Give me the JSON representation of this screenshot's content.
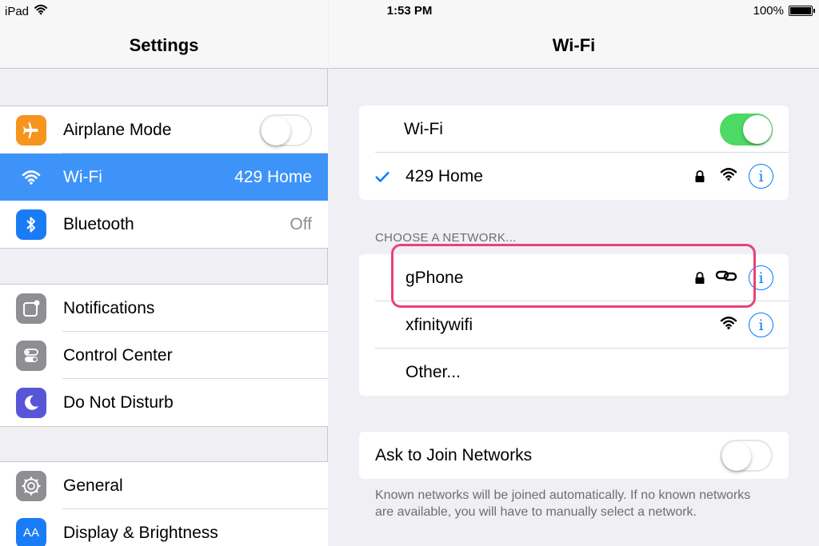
{
  "status_bar": {
    "device": "iPad",
    "time": "1:53 PM",
    "battery": "100%",
    "battery_level": 1.0
  },
  "left_pane": {
    "title": "Settings",
    "groups": [
      {
        "items": [
          {
            "label": "Airplane Mode",
            "icon": "airplane-icon",
            "icon_color": "#f7941d",
            "toggle": "off"
          },
          {
            "label": "Wi-Fi",
            "icon": "wifi-icon",
            "icon_color": "#3d93f8",
            "value": "429 Home",
            "selected": true
          },
          {
            "label": "Bluetooth",
            "icon": "bluetooth-icon",
            "icon_color": "#1a7cf5",
            "value": "Off"
          }
        ]
      },
      {
        "items": [
          {
            "label": "Notifications",
            "icon": "notifications-icon",
            "icon_color": "#8e8e93"
          },
          {
            "label": "Control Center",
            "icon": "control-center-icon",
            "icon_color": "#8e8e93"
          },
          {
            "label": "Do Not Disturb",
            "icon": "moon-icon",
            "icon_color": "#5856d6"
          }
        ]
      },
      {
        "items": [
          {
            "label": "General",
            "icon": "gear-icon",
            "icon_color": "#8e8e93"
          },
          {
            "label": "Display & Brightness",
            "icon": "display-icon",
            "icon_color": "#1a7cf5",
            "icon_text": "AA"
          }
        ]
      }
    ]
  },
  "right_pane": {
    "title": "Wi-Fi",
    "wifi_toggle_label": "Wi-Fi",
    "wifi_toggle": "on",
    "connected_network": "429 Home",
    "section_header": "CHOOSE A NETWORK...",
    "networks": [
      {
        "name": "gPhone",
        "locked": true,
        "signal_icon": "personal-hotspot-link-icon"
      },
      {
        "name": "xfinitywifi",
        "locked": false,
        "signal_icon": "wifi-signal-icon"
      },
      {
        "name": "Other..."
      }
    ],
    "ask_to_join_label": "Ask to Join Networks",
    "ask_to_join_toggle": "off",
    "footnote": "Known networks will be joined automatically. If no known networks are available, you will have to manually select a network."
  },
  "colors": {
    "accent": "#007aff",
    "selected_row": "#3d93f8",
    "toggle_on": "#4cd964",
    "highlight": "#e8427a"
  }
}
